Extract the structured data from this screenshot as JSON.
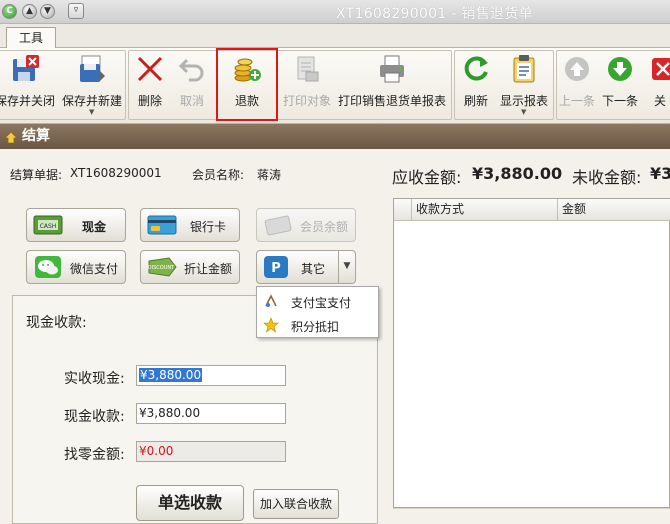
{
  "window": {
    "title": "XT1608290001 - 销售退货单"
  },
  "menu": {
    "tab_tools": "工具"
  },
  "toolbar": {
    "save_close": "保存并关闭",
    "save_new": "保存并新建",
    "delete": "删除",
    "cancel": "取消",
    "refund": "退款",
    "print_object": "打印对象",
    "print_report": "打印销售退货单报表",
    "refresh": "刷新",
    "show_report": "显示报表",
    "prev": "上一条",
    "next": "下一条",
    "close": "关"
  },
  "section": {
    "title": "结算"
  },
  "info": {
    "doc_label": "结算单据:",
    "doc_value": "XT1608290001",
    "member_label": "会员名称:",
    "member_value": "蒋涛",
    "receivable_label": "应收金额:",
    "receivable_value": "¥3,880.00",
    "unreceived_label": "未收金额:",
    "unreceived_value": "¥3"
  },
  "payment_methods": {
    "cash": "现金",
    "bank_card": "银行卡",
    "member_balance": "会员余额",
    "wechat": "微信支付",
    "discount": "折让金额",
    "other": "其它",
    "cash_icon_text": "CASH",
    "discount_icon_text": "DISCOUNT"
  },
  "cash_panel": {
    "title": "现金收款:",
    "received_label": "实收现金:",
    "received_value": "¥3,880.00",
    "collect_label": "现金收款:",
    "collect_value": "¥3,880.00",
    "change_label": "找零金额:",
    "change_value": "¥0.00",
    "single_button": "单选收款",
    "multi_button": "加入联合收款"
  },
  "grid": {
    "col_method": "收款方式",
    "col_amount": "金额"
  },
  "popup": {
    "alipay": "支付宝支付",
    "points": "积分抵扣"
  },
  "colors": {
    "highlight": "#e0161b",
    "section_header": "#7a6652",
    "change_value": "#d01818",
    "selection": "#3178d4"
  }
}
